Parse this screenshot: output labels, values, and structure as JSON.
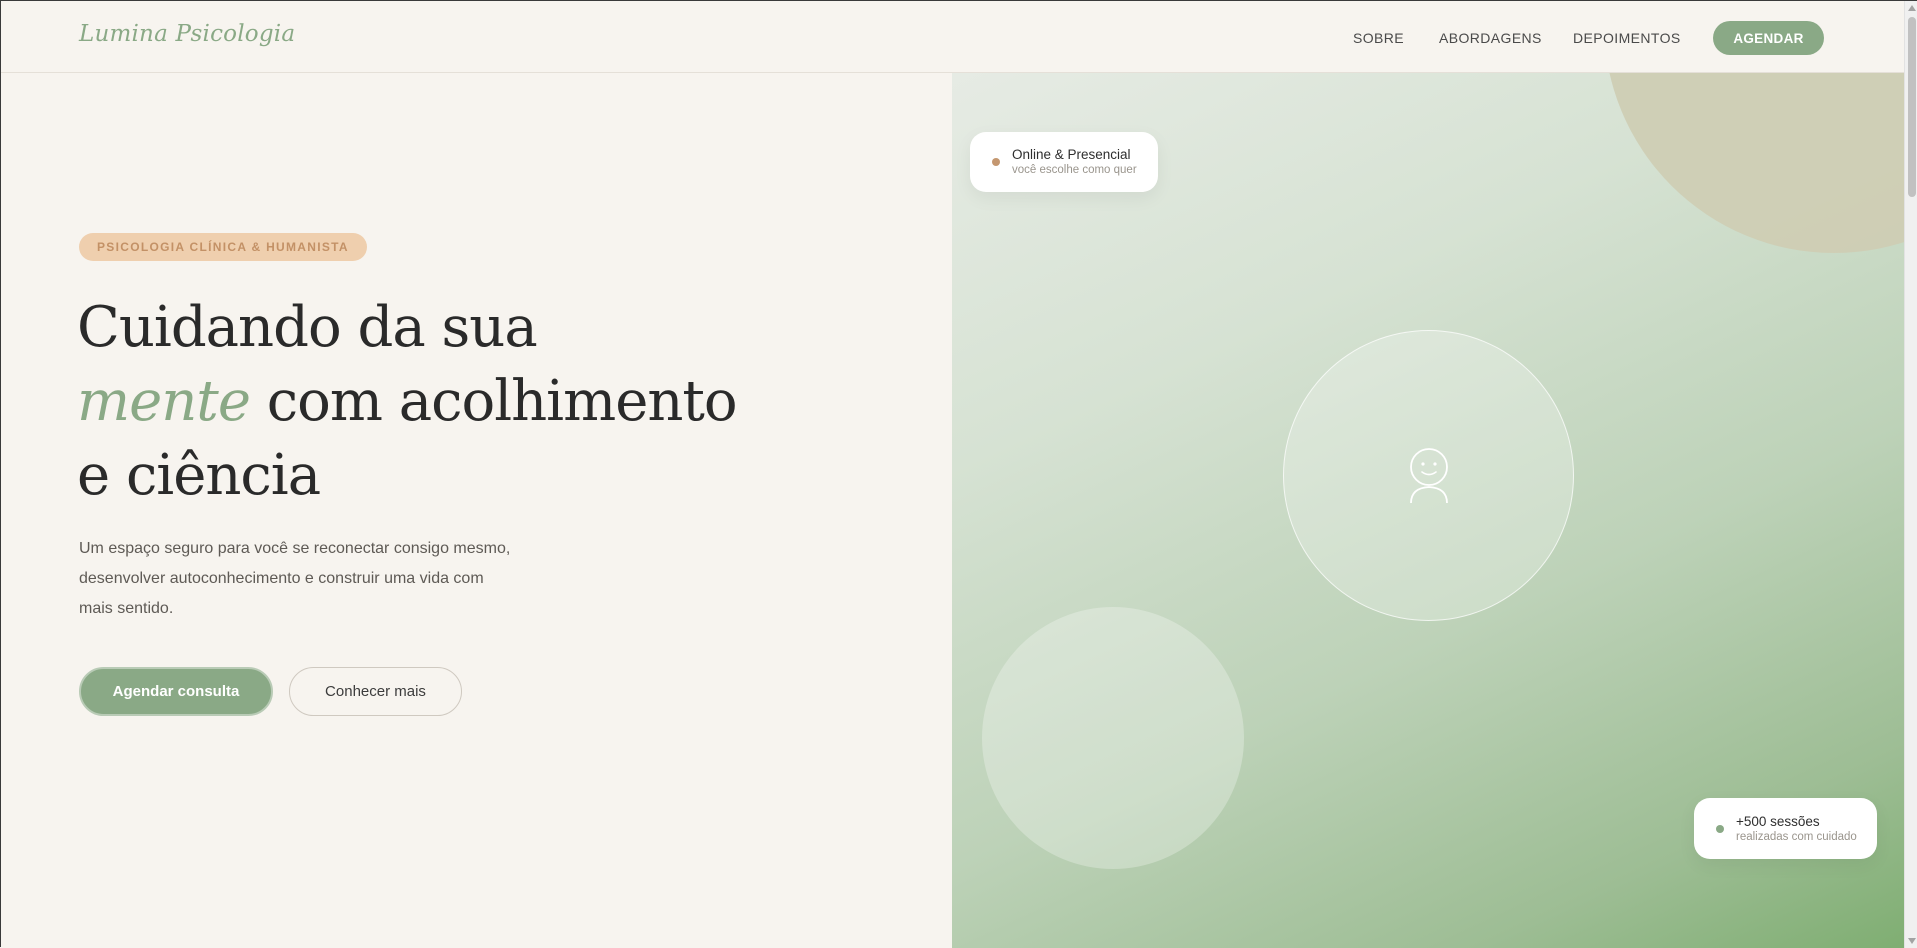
{
  "header": {
    "logo": "Lumina Psicologia",
    "nav": [
      {
        "label": "SOBRE"
      },
      {
        "label": "ABORDAGENS"
      },
      {
        "label": "DEPOIMENTOS"
      }
    ],
    "cta_label": "AGENDAR"
  },
  "hero": {
    "badge": "PSICOLOGIA CLÍNICA & HUMANISTA",
    "headline": {
      "line1": "Cuidando da sua",
      "accent": "mente",
      "line2_rest": " com acolhimento",
      "line3": "e ciência"
    },
    "lead": "Um espaço seguro para você se reconectar consigo mesmo, desenvolver autoconhecimento e construir uma vida com mais sentido.",
    "primary_button": "Agendar consulta",
    "secondary_button": "Conhecer mais"
  },
  "visual": {
    "center_icon": "person-smile-icon",
    "card_online": {
      "title": "Online & Presencial",
      "subtitle": "você escolhe como quer"
    },
    "card_sessions": {
      "title": "+500 sessões",
      "subtitle": "realizadas com cuidado"
    }
  },
  "colors": {
    "brand_green": "#8aa986",
    "background": "#f7f4ef",
    "badge_bg": "#efcfae",
    "accent_orange": "#c49770"
  }
}
